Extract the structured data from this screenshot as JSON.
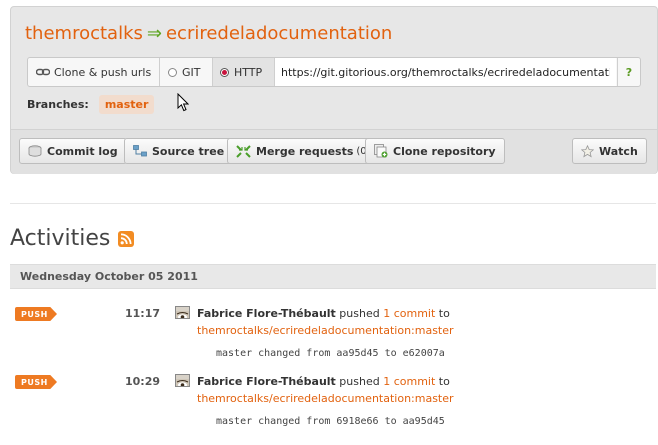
{
  "repo": {
    "owner": "themroctalks",
    "separator": "⇒",
    "name": "ecriredeladocumentation"
  },
  "clone_bar": {
    "clone_push_label": "Clone & push urls",
    "git_label": "GIT",
    "http_label": "HTTP",
    "url": "https://git.gitorious.org/themroctalks/ecriredeladocumentation",
    "help_label": "?"
  },
  "branches": {
    "label": "Branches:",
    "items": [
      "master"
    ]
  },
  "actions": {
    "commit_log": "Commit log",
    "source_tree": "Source tree",
    "merge_requests": "Merge requests",
    "merge_requests_count": "(0)",
    "clone_repository": "Clone repository",
    "watch": "Watch"
  },
  "activities": {
    "heading": "Activities",
    "date": "Wednesday October 05 2011",
    "items": [
      {
        "badge": "PUSH",
        "time": "11:17",
        "author": "Fabrice Flore-Thébault",
        "verb": " pushed ",
        "commit_link": "1 commit",
        "preposition": " to",
        "ref": "themroctalks/ecriredeladocumentation:master",
        "detail": "master changed from aa95d45 to e62007a"
      },
      {
        "badge": "PUSH",
        "time": "10:29",
        "author": "Fabrice Flore-Thébault",
        "verb": " pushed ",
        "commit_link": "1 commit",
        "preposition": " to",
        "ref": "themroctalks/ecriredeladocumentation:master",
        "detail": "master changed from 6918e66 to aa95d45"
      }
    ]
  },
  "colors": {
    "accent": "#e2620f",
    "push_badge": "#ee7a22",
    "arrow": "#5ea522"
  }
}
